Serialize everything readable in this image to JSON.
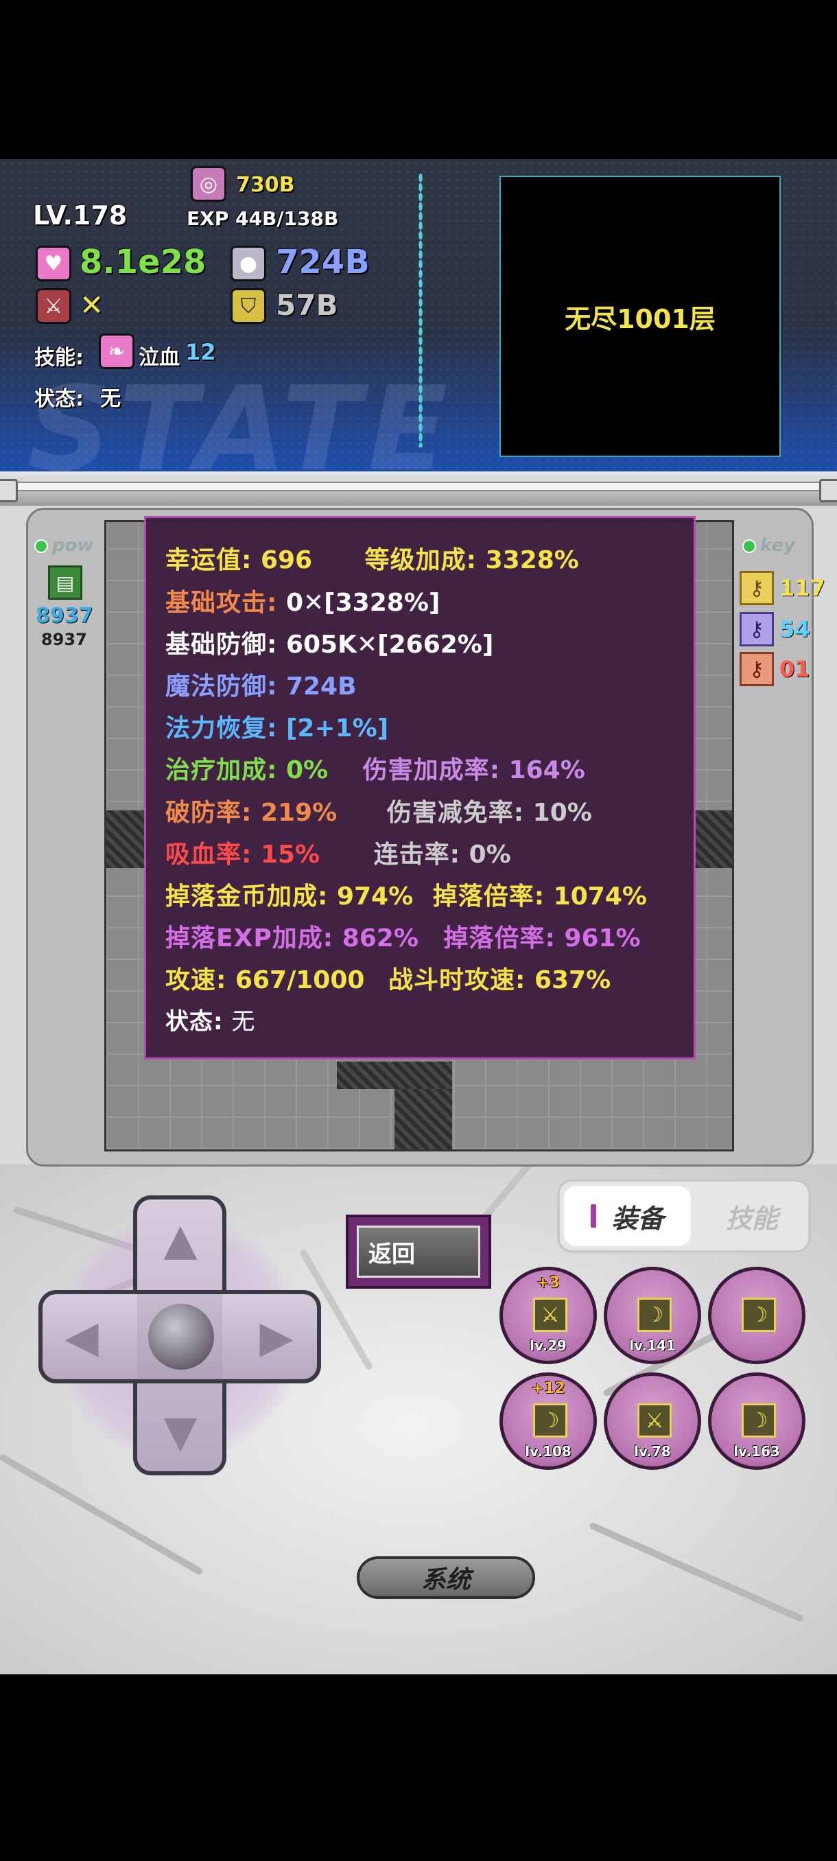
{
  "hud": {
    "level": "LV.178",
    "gold": "730B",
    "exp": "EXP 44B/138B",
    "hp": "8.1e28",
    "atk_mark": "✕",
    "mp": "724B",
    "def": "57B",
    "skill_label": "技能:",
    "skill_name": "泣血",
    "skill_level": "12",
    "state_label": "状态:",
    "state_value": "无",
    "watermark": "STATE",
    "floor": "无尽1001层"
  },
  "side_left": {
    "title": "pow",
    "value_big": "8937",
    "value_small": "8937"
  },
  "side_right": {
    "title": "key",
    "yellow_keys": "117",
    "blue_keys": "54",
    "red_keys": "01"
  },
  "stats": {
    "luck_label": "幸运值:",
    "luck_value": "696",
    "level_bonus_label": "等级加成:",
    "level_bonus_value": "3328%",
    "base_atk_label": "基础攻击:",
    "base_atk_value": "0✕[3328%]",
    "base_def_label": "基础防御:",
    "base_def_value": "605K✕[2662%]",
    "mdef_label": "魔法防御:",
    "mdef_value": "724B",
    "mp_regen_label": "法力恢复:",
    "mp_regen_value": "[2+1%]",
    "heal_label": "治疗加成:",
    "heal_value": "0%",
    "dmg_bonus_label": "伤害加成率:",
    "dmg_bonus_value": "164%",
    "pierce_label": "破防率:",
    "pierce_value": "219%",
    "dmg_reduce_label": "伤害减免率:",
    "dmg_reduce_value": "10%",
    "lifesteal_label": "吸血率:",
    "lifesteal_value": "15%",
    "combo_label": "连击率:",
    "combo_value": "0%",
    "gold_drop_label": "掉落金币加成:",
    "gold_drop_value": "974%",
    "gold_mult_label": "掉落倍率:",
    "gold_mult_value": "1074%",
    "exp_drop_label": "掉落EXP加成:",
    "exp_drop_value": "862%",
    "exp_mult_label": "掉落倍率:",
    "exp_mult_value": "961%",
    "speed_label": "攻速:",
    "speed_value": "667/1000",
    "battle_speed_label": "战斗时攻速:",
    "battle_speed_value": "637%",
    "status_label": "状态:",
    "status_value": "无"
  },
  "controls": {
    "back": "返回",
    "tab_equip": "装备",
    "tab_skill": "技能",
    "system": "系统"
  },
  "equipment": [
    {
      "plus": "+3",
      "level": "lv.29",
      "icon": "sword-icon"
    },
    {
      "plus": "",
      "level": "lv.141",
      "icon": "scythe-icon"
    },
    {
      "plus": "",
      "level": "",
      "icon": "scythe-icon"
    },
    {
      "plus": "+12",
      "level": "lv.108",
      "icon": "scythe-icon"
    },
    {
      "plus": "",
      "level": "lv.78",
      "icon": "sword-icon"
    },
    {
      "plus": "",
      "level": "lv.163",
      "icon": "scythe-icon"
    }
  ],
  "colors": {
    "gold": "#f4e44a",
    "hp_green": "#7fe04a",
    "mp_blue": "#8aa0ff",
    "orange": "#f08a4a",
    "purple": "#d26ee6",
    "red": "#ff4a4a"
  }
}
